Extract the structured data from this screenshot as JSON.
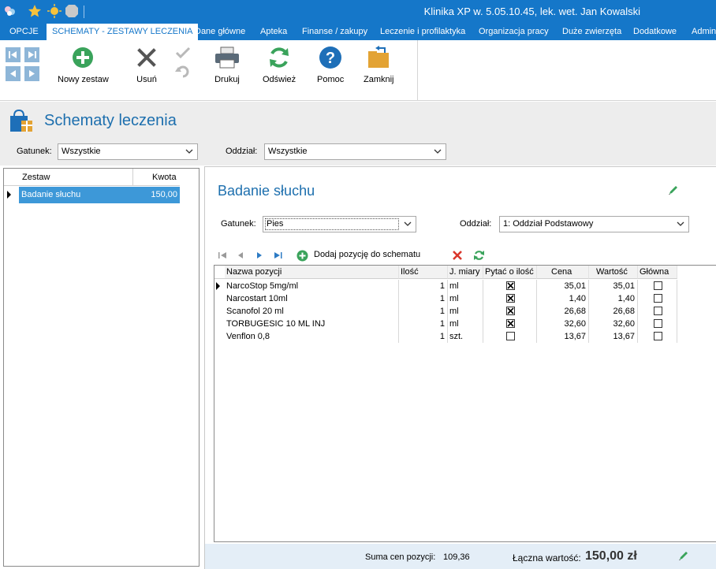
{
  "window": {
    "title": "Klinika XP w. 5.05.10.45, lek. wet. Jan Kowalski"
  },
  "tabs": [
    {
      "label": "OPCJE"
    },
    {
      "label": "SCHEMATY - ZESTAWY LECZENIA"
    },
    {
      "label": "Dane główne"
    },
    {
      "label": "Apteka"
    },
    {
      "label": "Finanse / zakupy"
    },
    {
      "label": "Leczenie i profilaktyka"
    },
    {
      "label": "Organizacja pracy"
    },
    {
      "label": "Duże zwierzęta"
    },
    {
      "label": "Dodatkowe"
    },
    {
      "label": "Admin"
    }
  ],
  "toolbar": {
    "new_set": "Nowy zestaw",
    "delete": "Usuń",
    "print": "Drukuj",
    "refresh": "Odśwież",
    "help": "Pomoc",
    "close": "Zamknij"
  },
  "page": {
    "title": "Schematy leczenia"
  },
  "filters": {
    "species_label": "Gatunek:",
    "species_value": "Wszystkie",
    "ward_label": "Oddział:",
    "ward_value": "Wszystkie"
  },
  "sets_list": {
    "headers": {
      "name": "Zestaw",
      "amount": "Kwota"
    },
    "rows": [
      {
        "name": "Badanie słuchu",
        "amount": "150,00"
      }
    ]
  },
  "detail": {
    "title": "Badanie słuchu",
    "species_label": "Gatunek:",
    "species_value": "Pies",
    "ward_label": "Oddział:",
    "ward_value": "1: Oddział Podstawowy",
    "add_position": "Dodaj pozycję do schematu"
  },
  "positions": {
    "headers": {
      "name": "Nazwa pozycji",
      "qty": "Ilość",
      "unit": "J. miary",
      "ask_qty": "Pytać o ilość",
      "price": "Cena",
      "value": "Wartość",
      "main": "Główna"
    },
    "rows": [
      {
        "name": "NarcoStop 5mg/ml",
        "qty": "1",
        "unit": "ml",
        "ask_qty": true,
        "price": "35,01",
        "value": "35,01",
        "main": false
      },
      {
        "name": "Narcostart 10ml",
        "qty": "1",
        "unit": "ml",
        "ask_qty": true,
        "price": "1,40",
        "value": "1,40",
        "main": false
      },
      {
        "name": "Scanofol 20 ml",
        "qty": "1",
        "unit": "ml",
        "ask_qty": true,
        "price": "26,68",
        "value": "26,68",
        "main": false
      },
      {
        "name": "TORBUGESIC 10 ML INJ",
        "qty": "1",
        "unit": "ml",
        "ask_qty": true,
        "price": "32,60",
        "value": "32,60",
        "main": false
      },
      {
        "name": "Venflon 0,8",
        "qty": "1",
        "unit": "szt.",
        "ask_qty": false,
        "price": "13,67",
        "value": "13,67",
        "main": false
      }
    ]
  },
  "summary": {
    "sum_label": "Suma cen pozycji:",
    "sum_value": "109,36",
    "total_label": "Łączna wartość:",
    "total_value": "150,00 zł"
  },
  "colors": {
    "brand_blue": "#1577c9",
    "title_blue": "#1d6fae",
    "selection": "#3d98d8",
    "green": "#3aa35b",
    "red_delete": "#d9362b"
  }
}
